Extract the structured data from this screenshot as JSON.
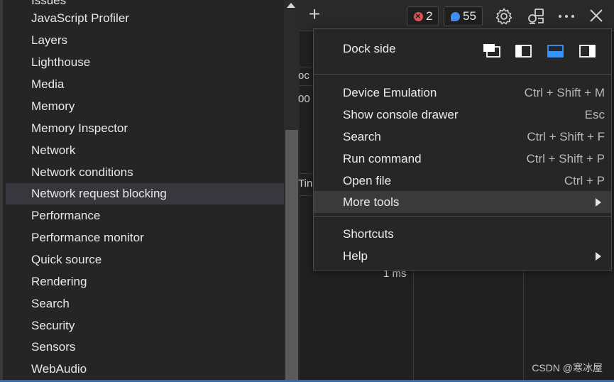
{
  "tools_list": {
    "partial_top": "Issues",
    "items": [
      "JavaScript Profiler",
      "Layers",
      "Lighthouse",
      "Media",
      "Memory",
      "Memory Inspector",
      "Network",
      "Network conditions",
      "Network request blocking",
      "Performance",
      "Performance monitor",
      "Quick source",
      "Rendering",
      "Search",
      "Security",
      "Sensors",
      "WebAudio"
    ],
    "highlighted": "Network request blocking"
  },
  "toolbar": {
    "new_tab_label": "+",
    "error_count": "2",
    "message_count": "55",
    "settings_icon": "gear-icon",
    "connect_icon": "devices-icon",
    "more_icon": "ellipsis-icon",
    "close_icon": "close-icon"
  },
  "background": {
    "frag_oc": "oc",
    "frag_00": "00",
    "frag_tin": "Tin",
    "timing": "1 ms"
  },
  "menu": {
    "dock_side_label": "Dock side",
    "dock_options": [
      "undock-icon",
      "dock-left-icon",
      "dock-bottom-icon",
      "dock-right-icon"
    ],
    "dock_selected": "dock-bottom-icon",
    "items": [
      {
        "label": "Device Emulation",
        "shortcut": "Ctrl + Shift + M"
      },
      {
        "label": "Show console drawer",
        "shortcut": "Esc"
      },
      {
        "label": "Search",
        "shortcut": "Ctrl + Shift + F"
      },
      {
        "label": "Run command",
        "shortcut": "Ctrl + Shift + P"
      },
      {
        "label": "Open file",
        "shortcut": "Ctrl + P"
      },
      {
        "label": "More tools",
        "shortcut": ""
      }
    ],
    "extra_items": [
      {
        "label": "Shortcuts"
      },
      {
        "label": "Help"
      }
    ]
  },
  "watermark": "CSDN @寒冰屋",
  "colors": {
    "accent": "#3794ff",
    "error": "#e05252",
    "message": "#3d8ef0"
  }
}
